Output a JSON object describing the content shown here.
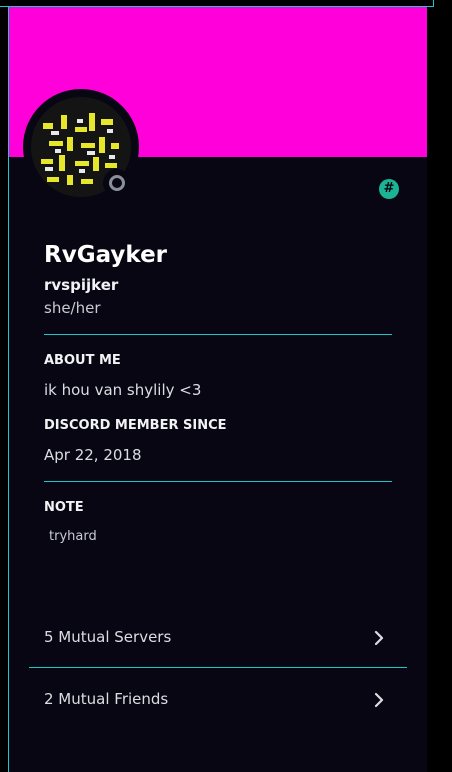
{
  "colors": {
    "banner": "#ff00db",
    "panel": "#070612",
    "accent_line": "#1fc6c6",
    "badge": "#1bb393",
    "status_offline": "#8a8f98"
  },
  "badge": {
    "icon": "hash-icon",
    "glyph": "#"
  },
  "profile": {
    "display_name": "RvGayker",
    "username": "rvspijker",
    "pronouns": "she/her",
    "status": "offline"
  },
  "about": {
    "title": "ABOUT ME",
    "text": "ik hou van shylily <3"
  },
  "member_since": {
    "title": "DISCORD MEMBER SINCE",
    "date": "Apr 22, 2018"
  },
  "note": {
    "title": "NOTE",
    "text": "tryhard"
  },
  "mutuals": [
    {
      "label": "5 Mutual Servers",
      "icon": "chevron-right-icon"
    },
    {
      "label": "2 Mutual Friends",
      "icon": "chevron-right-icon"
    }
  ]
}
